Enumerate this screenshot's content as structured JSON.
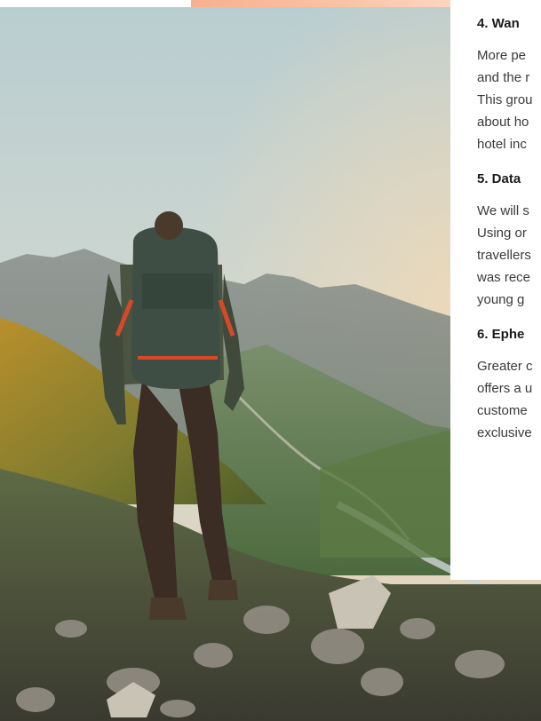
{
  "sections": [
    {
      "heading": "4. Wan",
      "lines": [
        "More pe",
        "and the r",
        "This grou",
        "about ho",
        "hotel inc"
      ]
    },
    {
      "heading": "5. Data",
      "lines": [
        "We will s",
        "Using or",
        "travellers",
        "was rece",
        "young g"
      ]
    },
    {
      "heading": "6. Ephe",
      "lines": [
        "Greater c",
        "offers a u",
        "custome",
        "exclusive"
      ]
    }
  ],
  "colors": {
    "accent": "#f7b08e",
    "heading": "#1a1a1a",
    "body_text": "#3a3a3a"
  }
}
